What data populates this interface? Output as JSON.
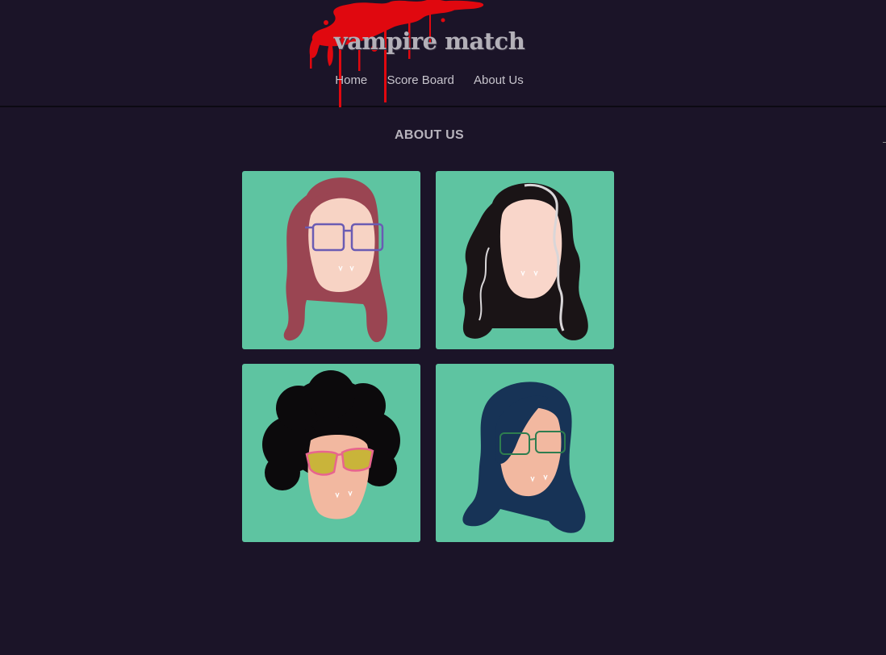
{
  "header": {
    "site_title": "vampire match",
    "nav": [
      {
        "label": "Home"
      },
      {
        "label": "Score Board"
      },
      {
        "label": "About Us"
      }
    ]
  },
  "main": {
    "section_title": "ABOUT US",
    "team": [
      {
        "avatar": "red-hair-glasses-avatar",
        "hair_color": "#9a4552",
        "glasses_color": "#6a5bb3"
      },
      {
        "avatar": "black-wavy-hair-avatar",
        "hair_color": "#1a1416"
      },
      {
        "avatar": "afro-sunglasses-avatar",
        "hair_color": "#0c0a0c",
        "glasses_color": "#c9b43a"
      },
      {
        "avatar": "navy-hair-glasses-avatar",
        "hair_color": "#173356",
        "glasses_color": "#2e7d4f"
      }
    ]
  },
  "colors": {
    "background": "#1b1428",
    "card": "#5ec4a1",
    "blood": "#e0080f",
    "text": "#b8b4bd"
  }
}
